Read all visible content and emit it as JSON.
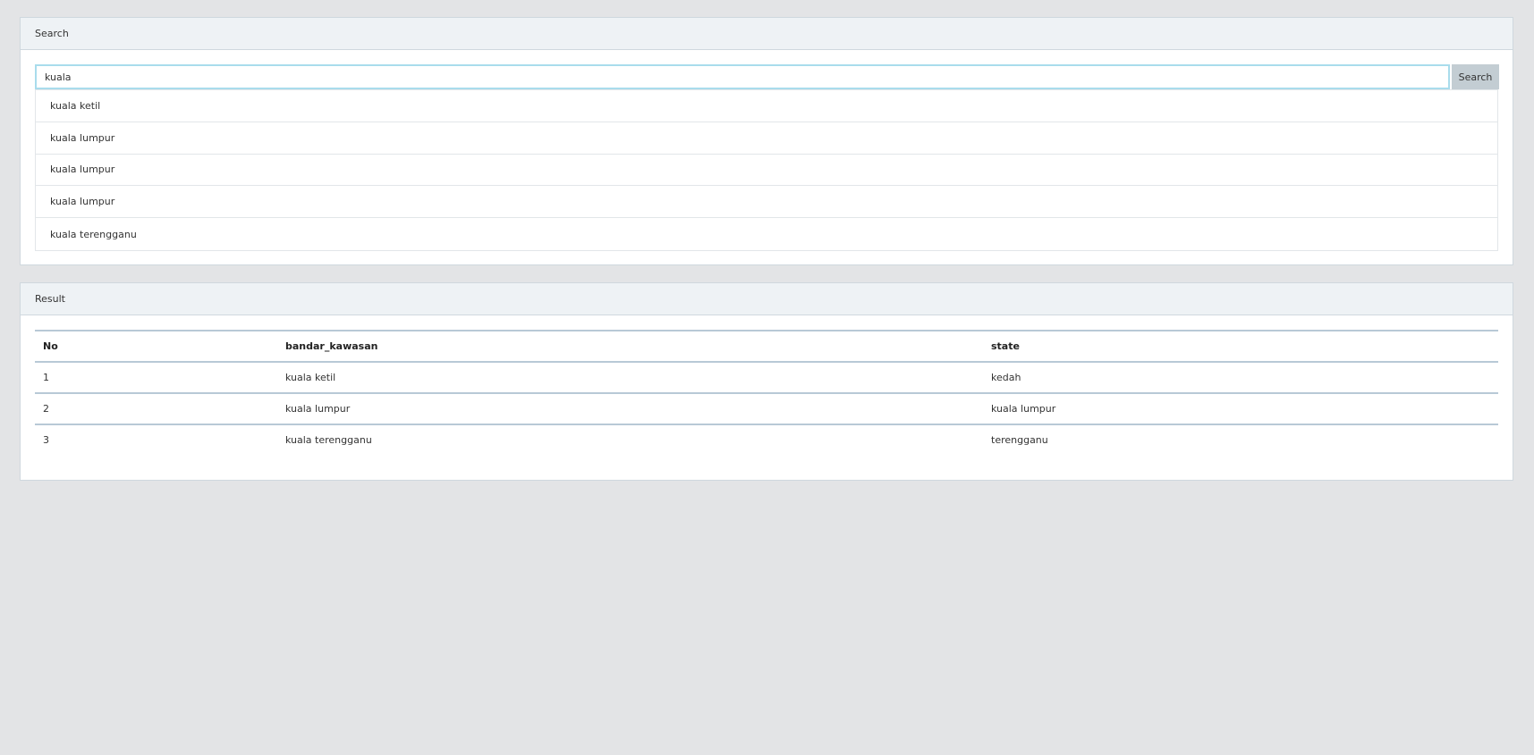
{
  "search_panel": {
    "heading": "Search",
    "input_value": "kuala",
    "button_label": "Search",
    "suggestions": [
      "kuala ketil",
      "kuala lumpur",
      "kuala lumpur",
      "kuala lumpur",
      "kuala terengganu"
    ]
  },
  "result_panel": {
    "heading": "Result",
    "columns": [
      "No",
      "bandar_kawasan",
      "state"
    ],
    "rows": [
      [
        "1",
        "kuala ketil",
        "kedah"
      ],
      [
        "2",
        "kuala lumpur",
        "kuala lumpur"
      ],
      [
        "3",
        "kuala terengganu",
        "terengganu"
      ]
    ]
  }
}
